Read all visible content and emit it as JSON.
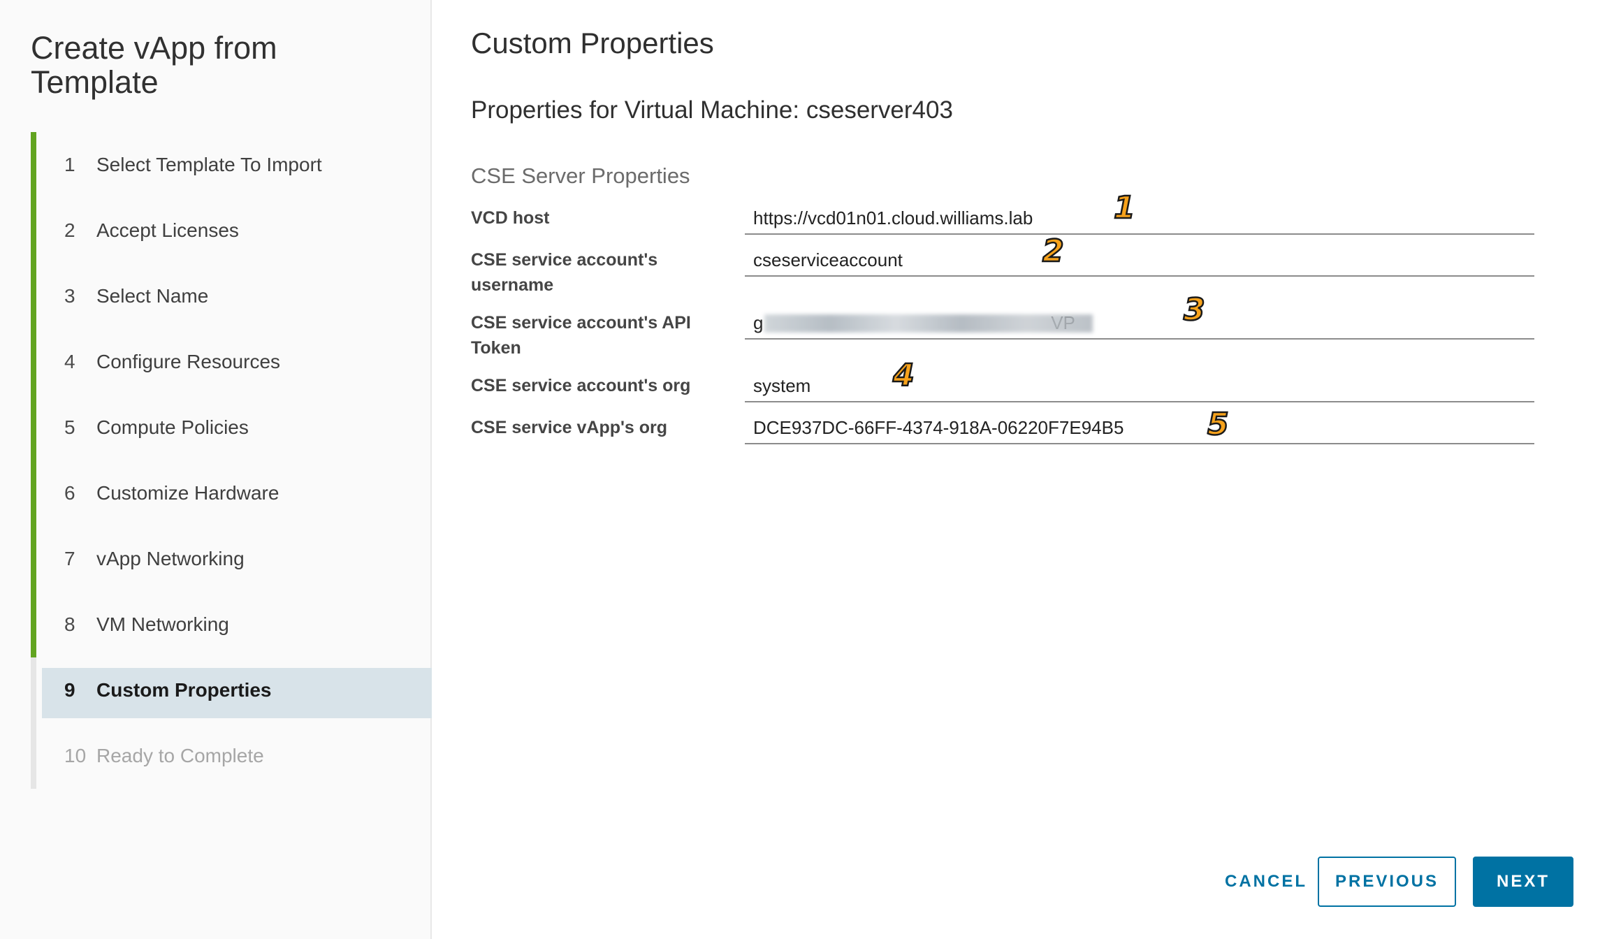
{
  "wizard": {
    "title": "Create vApp from Template",
    "steps": [
      {
        "number": "1",
        "label": "Select Template To Import",
        "state": "complete"
      },
      {
        "number": "2",
        "label": "Accept Licenses",
        "state": "complete"
      },
      {
        "number": "3",
        "label": "Select Name",
        "state": "complete"
      },
      {
        "number": "4",
        "label": "Configure Resources",
        "state": "complete"
      },
      {
        "number": "5",
        "label": "Compute Policies",
        "state": "complete"
      },
      {
        "number": "6",
        "label": "Customize Hardware",
        "state": "complete"
      },
      {
        "number": "7",
        "label": "vApp Networking",
        "state": "complete"
      },
      {
        "number": "8",
        "label": "VM Networking",
        "state": "complete"
      },
      {
        "number": "9",
        "label": "Custom Properties",
        "state": "current"
      },
      {
        "number": "10",
        "label": "Ready to Complete",
        "state": "pending"
      }
    ]
  },
  "main": {
    "page_title": "Custom Properties",
    "vm_heading": "Properties for Virtual Machine: cseserver403",
    "section_heading": "CSE Server Properties",
    "properties": [
      {
        "label": "VCD host",
        "value": "https://vcd01n01.cloud.williams.lab",
        "marker": "1"
      },
      {
        "label": "CSE service account's username",
        "value": "cseserviceaccount",
        "marker": "2"
      },
      {
        "label": "CSE service account's API Token",
        "value": "g                                                         VP",
        "marker": "3"
      },
      {
        "label": "CSE service account's org",
        "value": "system",
        "marker": "4"
      },
      {
        "label": "CSE service vApp's org",
        "value": "DCE937DC-66FF-4374-918A-06220F7E94B5",
        "marker": "5"
      }
    ]
  },
  "footer": {
    "cancel_label": "CANCEL",
    "previous_label": "PREVIOUS",
    "next_label": "NEXT"
  },
  "colors": {
    "accent": "#0072a3",
    "step_complete": "#62a420",
    "step_current_bg": "#d8e3e9",
    "marker": "#f7a21b"
  }
}
